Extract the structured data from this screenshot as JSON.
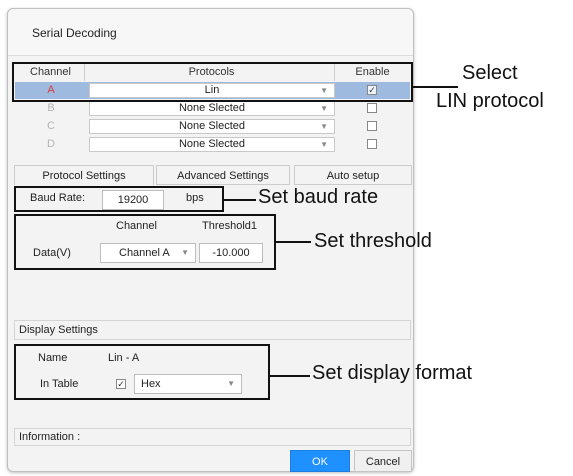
{
  "dialog": {
    "title": "Serial Decoding"
  },
  "channels_table": {
    "headers": [
      "Channel",
      "Protocols",
      "Enable"
    ],
    "rows": [
      {
        "channel": "A",
        "protocol": "Lin",
        "enabled": true
      },
      {
        "channel": "B",
        "protocol": "None Slected",
        "enabled": false
      },
      {
        "channel": "C",
        "protocol": "None Slected",
        "enabled": false
      },
      {
        "channel": "D",
        "protocol": "None Slected",
        "enabled": false
      }
    ]
  },
  "tabs": [
    "Protocol Settings",
    "Advanced Settings",
    "Auto setup"
  ],
  "baud": {
    "label": "Baud Rate:",
    "value": "19200",
    "unit": "bps"
  },
  "threshold": {
    "col_channel": "Channel",
    "col_threshold": "Threshold1",
    "row_label": "Data(V)",
    "channel_value": "Channel A",
    "threshold_value": "-10.000"
  },
  "display_settings": {
    "title": "Display Settings",
    "name_label": "Name",
    "name_value": "Lin - A",
    "in_table_label": "In Table",
    "in_table_checked": true,
    "format_value": "Hex"
  },
  "information_label": "Information :",
  "buttons": {
    "ok": "OK",
    "cancel": "Cancel"
  },
  "callouts": {
    "select_line1": "Select",
    "select_line2": "LIN protocol",
    "baud": "Set baud rate",
    "threshold": "Set threshold",
    "display": "Set display format"
  },
  "icons": {
    "dropdown": "chevron-down-icon",
    "checkbox": "checkbox-icon"
  },
  "colors": {
    "selected_row": "#9fbadf",
    "ok_button": "#1e90ff",
    "channel_a_text": "#d63a3a"
  }
}
